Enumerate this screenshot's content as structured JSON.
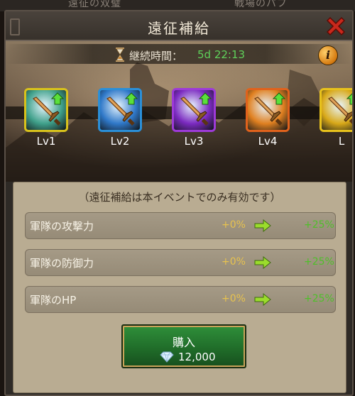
{
  "background_tabs": [
    "遠征の双璧",
    "戦場のパブ"
  ],
  "dialog": {
    "title": "遠征補給",
    "timer_label": "継続時間：",
    "timer_value": "5d 22:13"
  },
  "levels": [
    {
      "label": "Lv1",
      "frame_color": "#d8c21c",
      "gem_color": "#3fa08a"
    },
    {
      "label": "Lv2",
      "frame_color": "#2a8fd8",
      "gem_color": "#2f78c8"
    },
    {
      "label": "Lv3",
      "frame_color": "#9d3ad8",
      "gem_color": "#7b2ac0"
    },
    {
      "label": "Lv4",
      "frame_color": "#e0621c",
      "gem_color": "#e08020"
    },
    {
      "label": "L",
      "frame_color": "#e8c21c",
      "gem_color": "#d8a818"
    }
  ],
  "note": "（遠征補給は本イベントでのみ有効です）",
  "stats": [
    {
      "name": "軍隊の攻撃力",
      "current": "+0%",
      "next": "+25%"
    },
    {
      "name": "軍隊の防御力",
      "current": "+0%",
      "next": "+25%"
    },
    {
      "name": "軍隊のHP",
      "current": "+0%",
      "next": "+25%"
    }
  ],
  "buy": {
    "label": "購入",
    "price": "12,000"
  },
  "colors": {
    "timer_green": "#5fd05a",
    "current_yellow": "#e7c24e",
    "next_green": "#4fbf2a"
  },
  "icons": {
    "close": "close-icon",
    "info": "info-icon",
    "hourglass": "hourglass-icon",
    "diamond": "diamond-icon",
    "arrow": "arrow-right-icon",
    "sword": "sword-icon",
    "up_arrow": "level-up-arrow-icon"
  }
}
